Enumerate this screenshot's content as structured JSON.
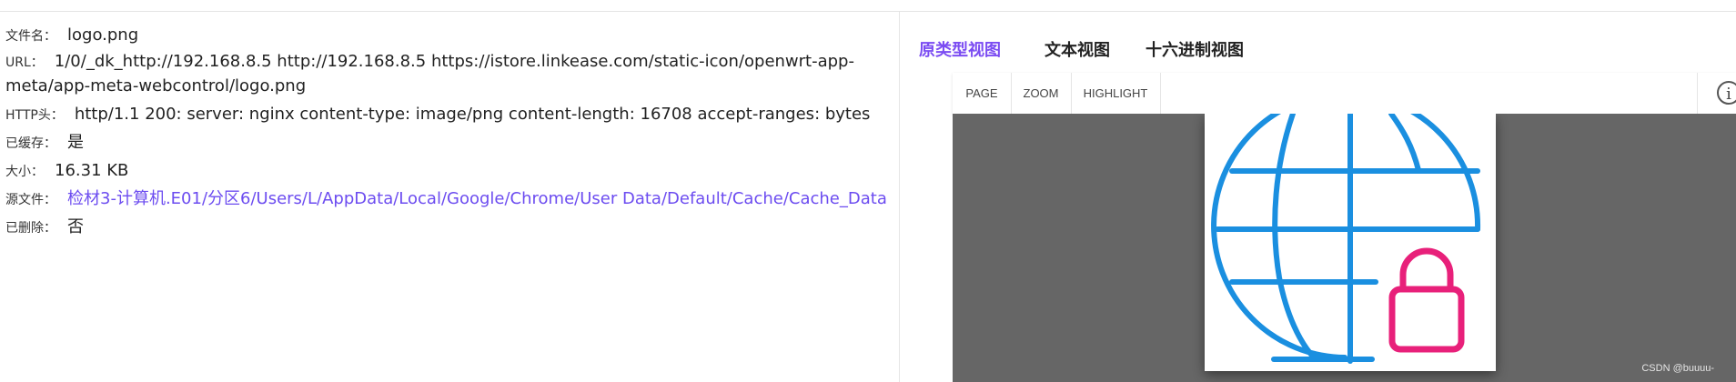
{
  "info": {
    "rows": [
      {
        "key": "文件名：",
        "value": "logo.png"
      },
      {
        "key": "URL：",
        "value": "1/0/_dk_http://192.168.8.5 http://192.168.8.5 https://istore.linkease.com/static-icon/openwrt-app-meta/app-meta-webcontrol/logo.png"
      },
      {
        "key": "HTTP头：",
        "value": "http/1.1 200: server: nginx content-type: image/png content-length: 16708 accept-ranges: bytes"
      },
      {
        "key": "已缓存：",
        "value": "是"
      },
      {
        "key": "大小：",
        "value": "16.31 KB"
      },
      {
        "key": "源文件：",
        "value": "检材3-计算机.E01/分区6/Users/L/AppData/Local/Google/Chrome/User Data/Default/Cache/Cache_Data"
      },
      {
        "key": "已删除：",
        "value": "否"
      }
    ]
  },
  "tabs": {
    "items": [
      {
        "label": "原类型视图",
        "active": true
      },
      {
        "label": "文本视图",
        "active": false
      },
      {
        "label": "十六进制视图",
        "active": false
      }
    ]
  },
  "viewer": {
    "toolbar": {
      "page": "PAGE",
      "zoom": "ZOOM",
      "highlight": "HIGHLIGHT",
      "info_glyph": "i"
    },
    "icons": {
      "info": "info-circle-icon",
      "image": "globe-lock-icon"
    }
  },
  "watermark": "CSDN @buuuu-",
  "colors": {
    "accent": "#7b4cf2",
    "link": "#6c4cf0",
    "globe": "#1a8fe0",
    "lock": "#e8207a",
    "stage": "#666666"
  }
}
